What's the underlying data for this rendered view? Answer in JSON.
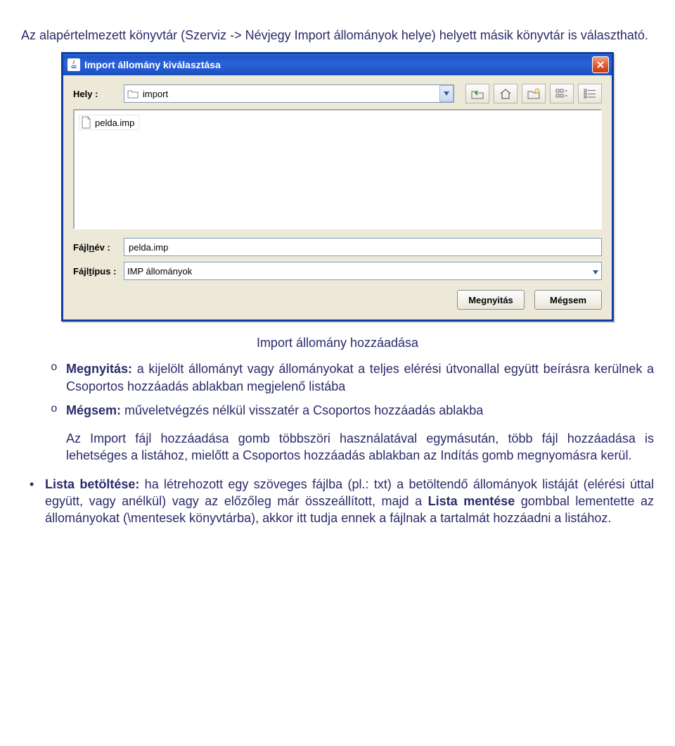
{
  "intro_text": "Az alapértelmezett könyvtár (Szerviz -> Névjegy Import állományok helye) helyett másik könyvtár is választható.",
  "dialog": {
    "title": "Import állomány kiválasztása",
    "location_label": "Hely :",
    "location_value": "import",
    "file_item": "pelda.imp",
    "filename_label_pre": "Fájl",
    "filename_label_ul": "n",
    "filename_label_post": "év :",
    "filename_value": "pelda.imp",
    "filetype_label_pre": "Fájl",
    "filetype_label_ul": "t",
    "filetype_label_post": "ípus :",
    "filetype_value": "IMP állományok",
    "open_btn": "Megnyitás",
    "cancel_btn": "Mégsem"
  },
  "caption": "Import állomány hozzáadása",
  "list": {
    "open_label": "Megnyitás:",
    "open_text": " a kijelölt állományt vagy állományokat a teljes elérési útvonallal együtt beírásra kerülnek a Csoportos hozzáadás ablakban megjelenő listába",
    "cancel_label": "Mégsem:",
    "cancel_text": " műveletvégzés nélkül visszatér a Csoportos hozzáadás ablakba"
  },
  "paragraph": "Az Import fájl hozzáadása gomb többszöri használatával egymásután, több fájl hozzáadása is lehetséges a listához, mielőtt a Csoportos hozzáadás ablakban az Indítás gomb megnyomásra kerül.",
  "bullet": {
    "label": "Lista betöltése:",
    "text_before": " ha létrehozott egy szöveges fájlba (pl.: txt) a betöltendő állományok listáját (elérési úttal együtt, vagy anélkül) vagy az előzőleg már összeállított, majd a ",
    "bold_mid": "Lista mentése",
    "text_after": " gombbal lementette az állományokat (\\mentesek könyvtárba), akkor itt tudja ennek a fájlnak a tartalmát hozzáadni a listához."
  }
}
